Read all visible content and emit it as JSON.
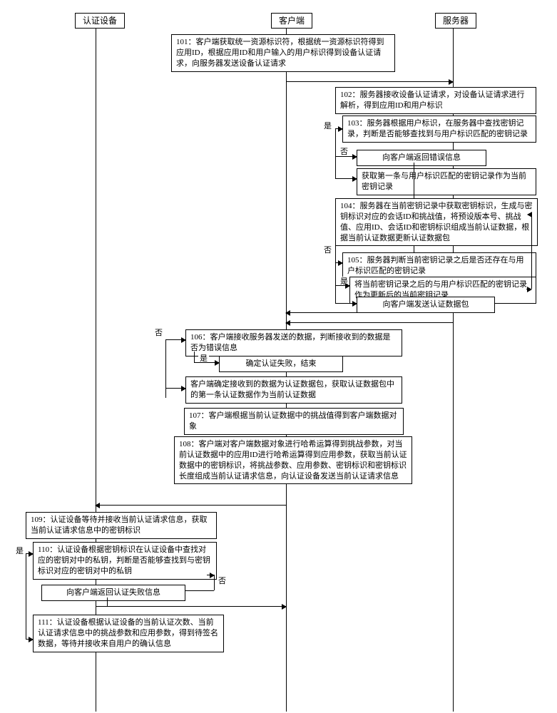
{
  "lanes": {
    "auth_device": "认证设备",
    "client": "客户端",
    "server": "服务器"
  },
  "steps": {
    "s101": "101：客户端获取统一资源标识符，根据统一资源标识符得到应用ID，根据应用ID和用户输入的用户标识得到设备认证请求，向服务器发送设备认证请求",
    "s102": "102：服务器接收设备认证请求，对设备认证请求进行解析，得到应用ID和用户标识",
    "s103": "103：服务器根据用户标识，在服务器中查找密钥记录，判断是否能够查找到与用户标识匹配的密钥记录",
    "s103_no": "向客户端返回错误信息",
    "s103_yes": "获取第一条与用户标识匹配的密钥记录作为当前密钥记录",
    "s104": "104：服务器在当前密钥记录中获取密钥标识，生成与密钥标识对应的会话ID和挑战值，将预设版本号、挑战值、应用ID、会话ID和密钥标识组成当前认证数据，根据当前认证数据更新认证数据包",
    "s105": "105：服务器判断当前密钥记录之后是否还存在与用户标识匹配的密钥记录",
    "s105_yes": "将当前密钥记录之后的与用户标识匹配的密钥记录作为更新后的当前密钥记录",
    "s105_no": "向客户端发送认证数据包",
    "s106": "106：客户端接收服务器发送的数据，判断接收到的数据是否为错误信息",
    "s106_yes": "确定认证失败，结束",
    "s106_no": "客户端确定接收到的数据为认证数据包，获取认证数据包中的第一条认证数据作为当前认证数据",
    "s107": "107：客户端根据当前认证数据中的挑战值得到客户端数据对象",
    "s108": "108：客户端对客户端数据对象进行哈希运算得到挑战参数，对当前认证数据中的应用ID进行哈希运算得到应用参数，获取当前认证数据中的密钥标识，将挑战参数、应用参数、密钥标识和密钥标识长度组成当前认证请求信息，向认证设备发送当前认证请求信息",
    "s109": "109：认证设备等待并接收当前认证请求信息，获取当前认证请求信息中的密钥标识",
    "s110": "110：认证设备根据密钥标识在认证设备中查找对应的密钥对中的私钥，判断是否能够查找到与密钥标识对应的密钥对中的私钥",
    "s110_no": "向客户端返回认证失败信息",
    "s111": "111：认证设备根据认证设备的当前认证次数、当前认证请求信息中的挑战参数和应用参数，得到待签名数据，等待并接收来自用户的确认信息"
  },
  "labels": {
    "yes": "是",
    "no": "否"
  }
}
